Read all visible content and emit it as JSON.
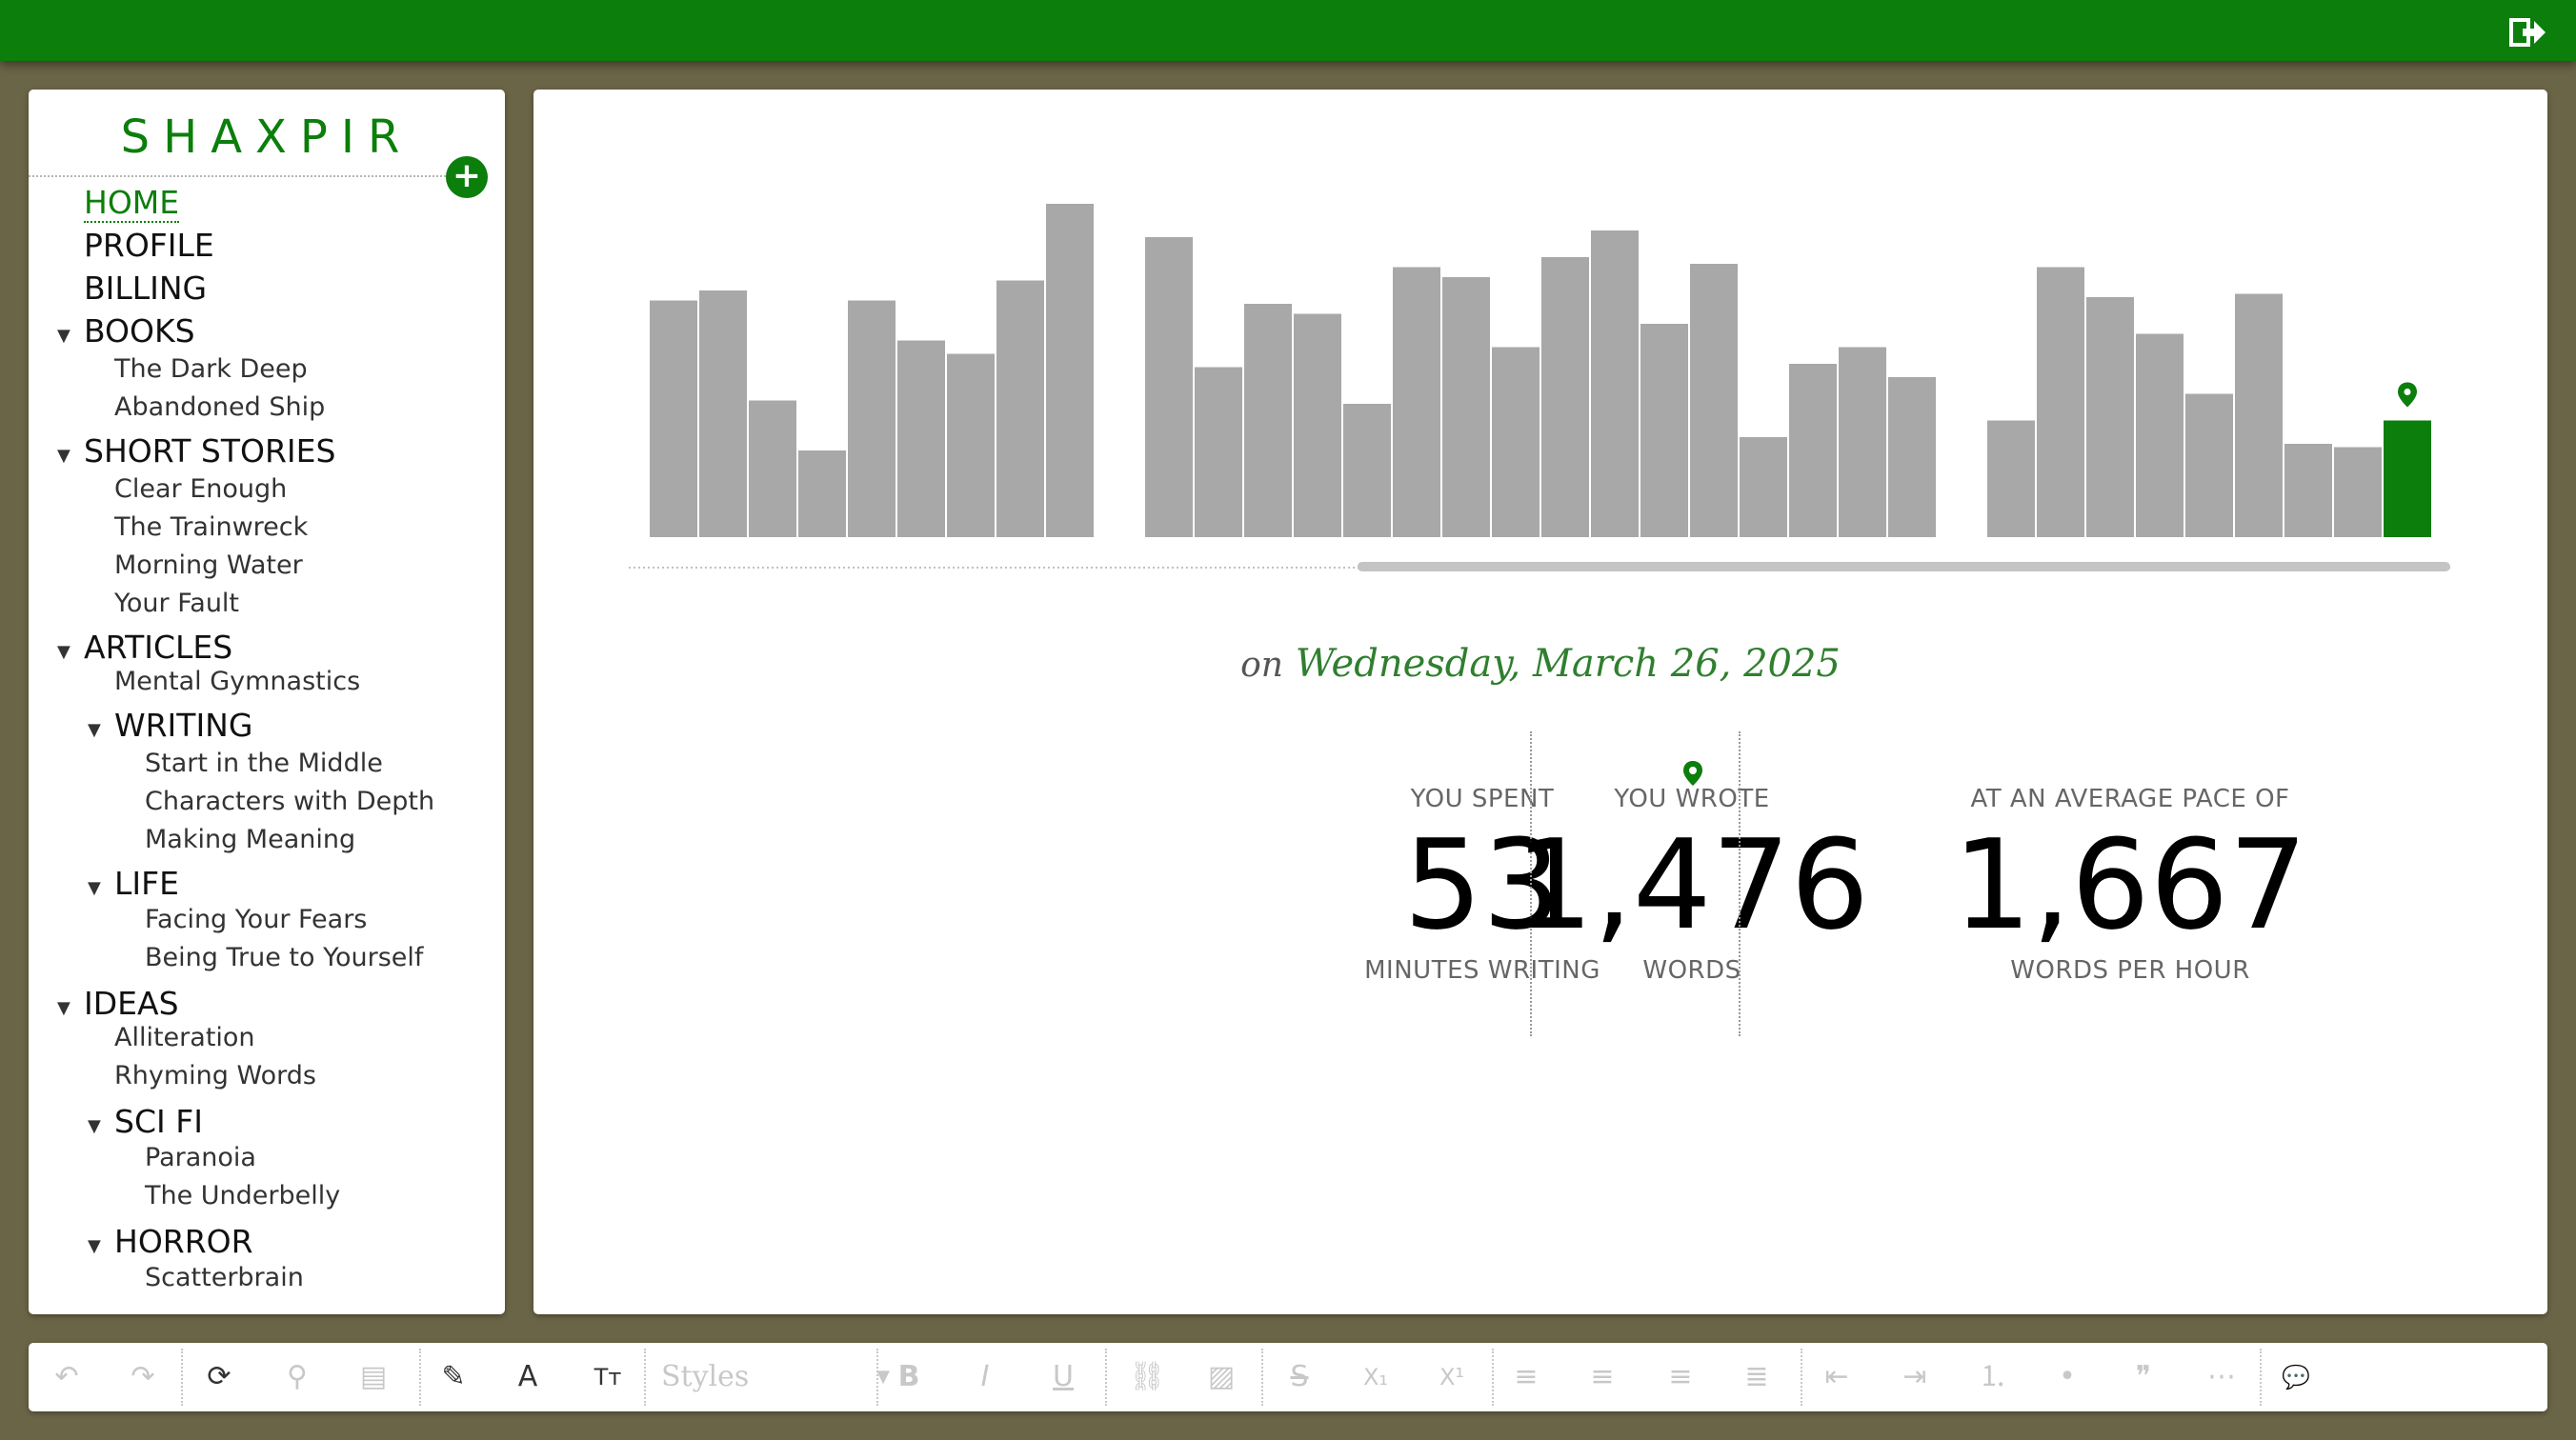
{
  "app": {
    "logo": "SHAXPIR",
    "add_label": "+",
    "colors": {
      "brand": "#0b7e0b",
      "bar": "#a8a8a8",
      "background": "#6b6547"
    },
    "logout_icon": "logout-icon"
  },
  "sidebar": {
    "items": [
      {
        "label": "HOME",
        "level": 0,
        "active": true
      },
      {
        "label": "PROFILE",
        "level": 0
      },
      {
        "label": "BILLING",
        "level": 0
      },
      {
        "label": "BOOKS",
        "level": 0,
        "expanded": true
      },
      {
        "label": "The Dark Deep",
        "level": 1
      },
      {
        "label": "Abandoned Ship",
        "level": 1
      },
      {
        "label": "SHORT STORIES",
        "level": 0,
        "expanded": true
      },
      {
        "label": "Clear Enough",
        "level": 1
      },
      {
        "label": "The Trainwreck",
        "level": 1
      },
      {
        "label": "Morning Water",
        "level": 1
      },
      {
        "label": "Your Fault",
        "level": 1
      },
      {
        "label": "ARTICLES",
        "level": 0,
        "expanded": true
      },
      {
        "label": "Mental Gymnastics",
        "level": 1
      },
      {
        "label": "WRITING",
        "level": 1,
        "expanded": true,
        "folder": true
      },
      {
        "label": "Start in the Middle",
        "level": 2
      },
      {
        "label": "Characters with Depth",
        "level": 2
      },
      {
        "label": "Making Meaning",
        "level": 2
      },
      {
        "label": "LIFE",
        "level": 1,
        "expanded": true,
        "folder": true
      },
      {
        "label": "Facing Your Fears",
        "level": 2
      },
      {
        "label": "Being True to Yourself",
        "level": 2
      },
      {
        "label": "IDEAS",
        "level": 0,
        "expanded": true
      },
      {
        "label": "Alliteration",
        "level": 1
      },
      {
        "label": "Rhyming Words",
        "level": 1
      },
      {
        "label": "SCI FI",
        "level": 1,
        "expanded": true,
        "folder": true
      },
      {
        "label": "Paranoia",
        "level": 2
      },
      {
        "label": "The Underbelly",
        "level": 2
      },
      {
        "label": "HORROR",
        "level": 1,
        "expanded": true,
        "folder": true
      },
      {
        "label": "Scatterbrain",
        "level": 2
      }
    ]
  },
  "chart_data": {
    "type": "bar",
    "groups": [
      [
        0.71,
        0.74,
        0.41,
        0.26,
        0.71,
        0.59,
        0.55,
        0.77,
        1.0
      ],
      [
        0.9,
        0.51,
        0.7,
        0.67,
        0.4,
        0.81,
        0.78,
        0.57,
        0.84,
        0.92,
        0.64,
        0.82,
        0.3,
        0.52,
        0.57,
        0.48
      ],
      [
        0.35,
        0.81,
        0.72,
        0.61,
        0.43,
        0.73,
        0.28,
        0.27,
        0.35
      ]
    ],
    "selected": {
      "group": 2,
      "index": 8
    },
    "scroll": {
      "start": 0.4,
      "end": 1.0
    }
  },
  "summary": {
    "date_prefix": "on",
    "date": "Wednesday, March 26, 2025",
    "stats": [
      {
        "top": "YOU SPENT",
        "value": "53",
        "bottom": "MINUTES WRITING"
      },
      {
        "top": "YOU WROTE",
        "value": "1,476",
        "bottom": "WORDS",
        "pin": true
      },
      {
        "top": "AT AN AVERAGE PACE OF",
        "value": "1,667",
        "bottom": "WORDS PER HOUR"
      }
    ]
  },
  "toolbar": {
    "styles_placeholder": "Styles",
    "buttons": [
      {
        "name": "undo",
        "glyph": "↶"
      },
      {
        "name": "redo",
        "glyph": "↷"
      },
      {
        "name": "refresh",
        "glyph": "⟳",
        "active": true
      },
      {
        "name": "search",
        "glyph": "⚲"
      },
      {
        "name": "notebook",
        "glyph": "▤"
      },
      {
        "name": "highlighter",
        "glyph": "✎",
        "active": true
      },
      {
        "name": "font-color",
        "glyph": "A",
        "active": true
      },
      {
        "name": "font-size",
        "glyph": "Tт",
        "active": true
      },
      {
        "name": "bold",
        "glyph": "B"
      },
      {
        "name": "italic",
        "glyph": "I"
      },
      {
        "name": "underline",
        "glyph": "U"
      },
      {
        "name": "link",
        "glyph": "⛓"
      },
      {
        "name": "image",
        "glyph": "▨"
      },
      {
        "name": "strikethrough",
        "glyph": "S"
      },
      {
        "name": "subscript",
        "glyph": "X₁"
      },
      {
        "name": "superscript",
        "glyph": "X¹"
      },
      {
        "name": "align-left",
        "glyph": "≡"
      },
      {
        "name": "align-center",
        "glyph": "≡"
      },
      {
        "name": "align-right",
        "glyph": "≡"
      },
      {
        "name": "align-justify",
        "glyph": "≣"
      },
      {
        "name": "outdent",
        "glyph": "⇤"
      },
      {
        "name": "indent",
        "glyph": "⇥"
      },
      {
        "name": "numbered-list",
        "glyph": "⒈"
      },
      {
        "name": "bullet-list",
        "glyph": "•"
      },
      {
        "name": "quote",
        "glyph": "❞"
      },
      {
        "name": "more",
        "glyph": "⋯"
      },
      {
        "name": "comment",
        "glyph": "💬"
      }
    ]
  }
}
